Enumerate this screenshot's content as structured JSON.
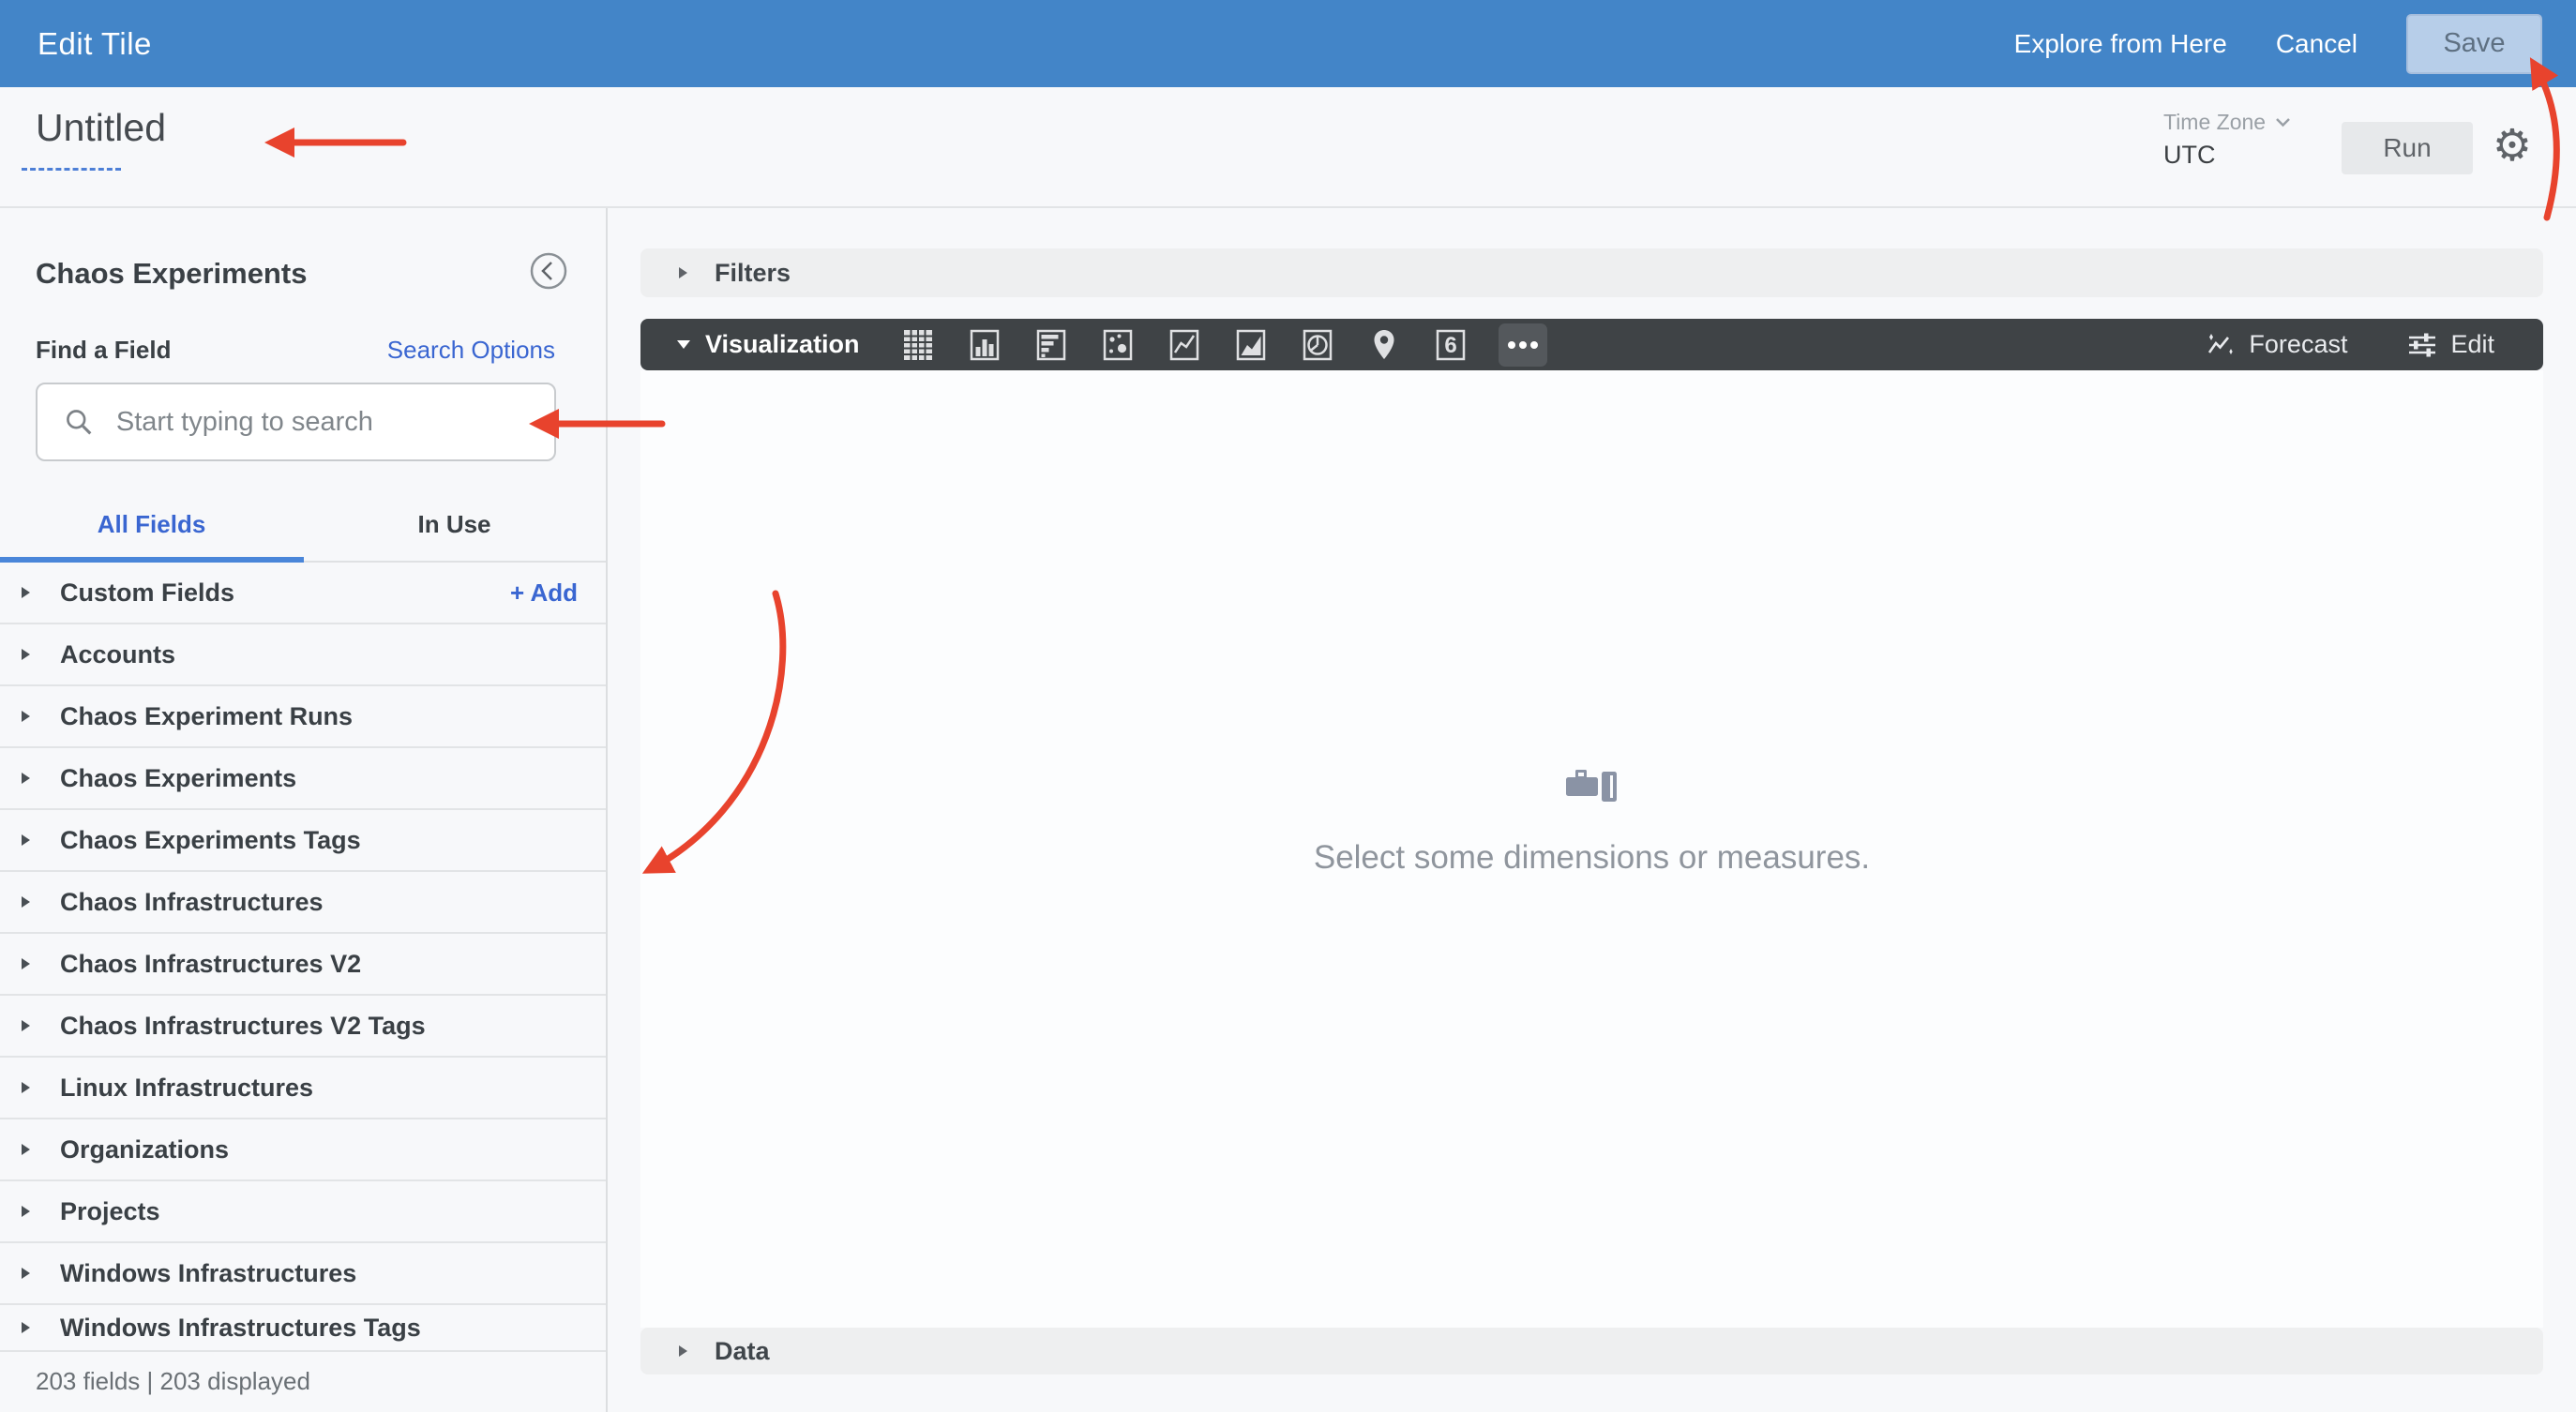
{
  "colors": {
    "top_bar_blue": "#4385c8",
    "link_blue": "#3a66d1",
    "tab_underline_blue": "#4a86d9",
    "viz_bar_dark": "#3f4346",
    "section_bar_gray": "#eeeff0",
    "save_button_bg": "#b7cee9",
    "page_background": "#f7f8fa",
    "annotation_red": "#e8432d"
  },
  "top_bar": {
    "title": "Edit Tile",
    "explore_label": "Explore from Here",
    "cancel_label": "Cancel",
    "save_label": "Save"
  },
  "toolbar": {
    "title": "Untitled",
    "time_zone_label": "Time Zone",
    "time_zone_value": "UTC",
    "run_label": "Run"
  },
  "sidebar": {
    "title": "Chaos Experiments",
    "find_field_label": "Find a Field",
    "search_options_label": "Search Options",
    "search_placeholder": "Start typing to search",
    "tabs": {
      "all_fields": "All Fields",
      "in_use": "In Use"
    },
    "custom_fields": {
      "label": "Custom Fields",
      "add_label": "+ Add"
    },
    "fields": [
      {
        "label": "Accounts"
      },
      {
        "label": "Chaos Experiment Runs"
      },
      {
        "label": "Chaos Experiments"
      },
      {
        "label": "Chaos Experiments Tags"
      },
      {
        "label": "Chaos Infrastructures"
      },
      {
        "label": "Chaos Infrastructures V2"
      },
      {
        "label": "Chaos Infrastructures V2 Tags"
      },
      {
        "label": "Linux Infrastructures"
      },
      {
        "label": "Organizations"
      },
      {
        "label": "Projects"
      },
      {
        "label": "Windows Infrastructures"
      },
      {
        "label": "Windows Infrastructures Tags"
      }
    ],
    "footer": "203 fields | 203 displayed"
  },
  "main": {
    "filters_label": "Filters",
    "visualization_label": "Visualization",
    "viz_types": [
      "table",
      "column",
      "bar",
      "scatterplot",
      "line",
      "area",
      "pie",
      "map",
      "single-value",
      "more"
    ],
    "single_value_glyph": "6",
    "forecast_label": "Forecast",
    "edit_label": "Edit",
    "empty_state_message": "Select some dimensions or measures."
  }
}
